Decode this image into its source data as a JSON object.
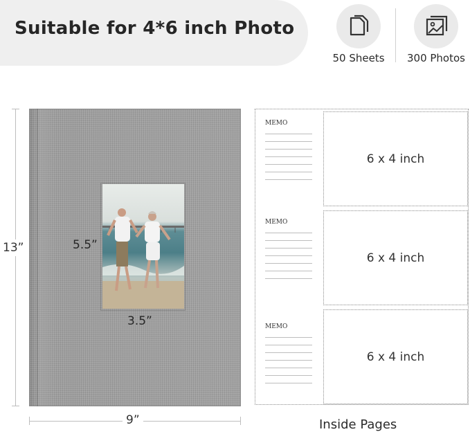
{
  "banner": {
    "title": "Suitable for 4*6 inch Photo"
  },
  "features": [
    {
      "icon": "pages-icon",
      "label": "50 Sheets"
    },
    {
      "icon": "photos-icon",
      "label": "300 Photos"
    }
  ],
  "dimensions": {
    "height": "13”",
    "width": "9”",
    "window_height": "5.5”",
    "window_width": "3.5”"
  },
  "inside": {
    "memo_label": "MEMO",
    "slots": [
      "6 x 4 inch",
      "6 x 4 inch",
      "6 x 4 inch"
    ],
    "caption": "Inside Pages"
  },
  "colors": {
    "banner_bg": "#efefef",
    "cover": "#9e9e9e"
  }
}
